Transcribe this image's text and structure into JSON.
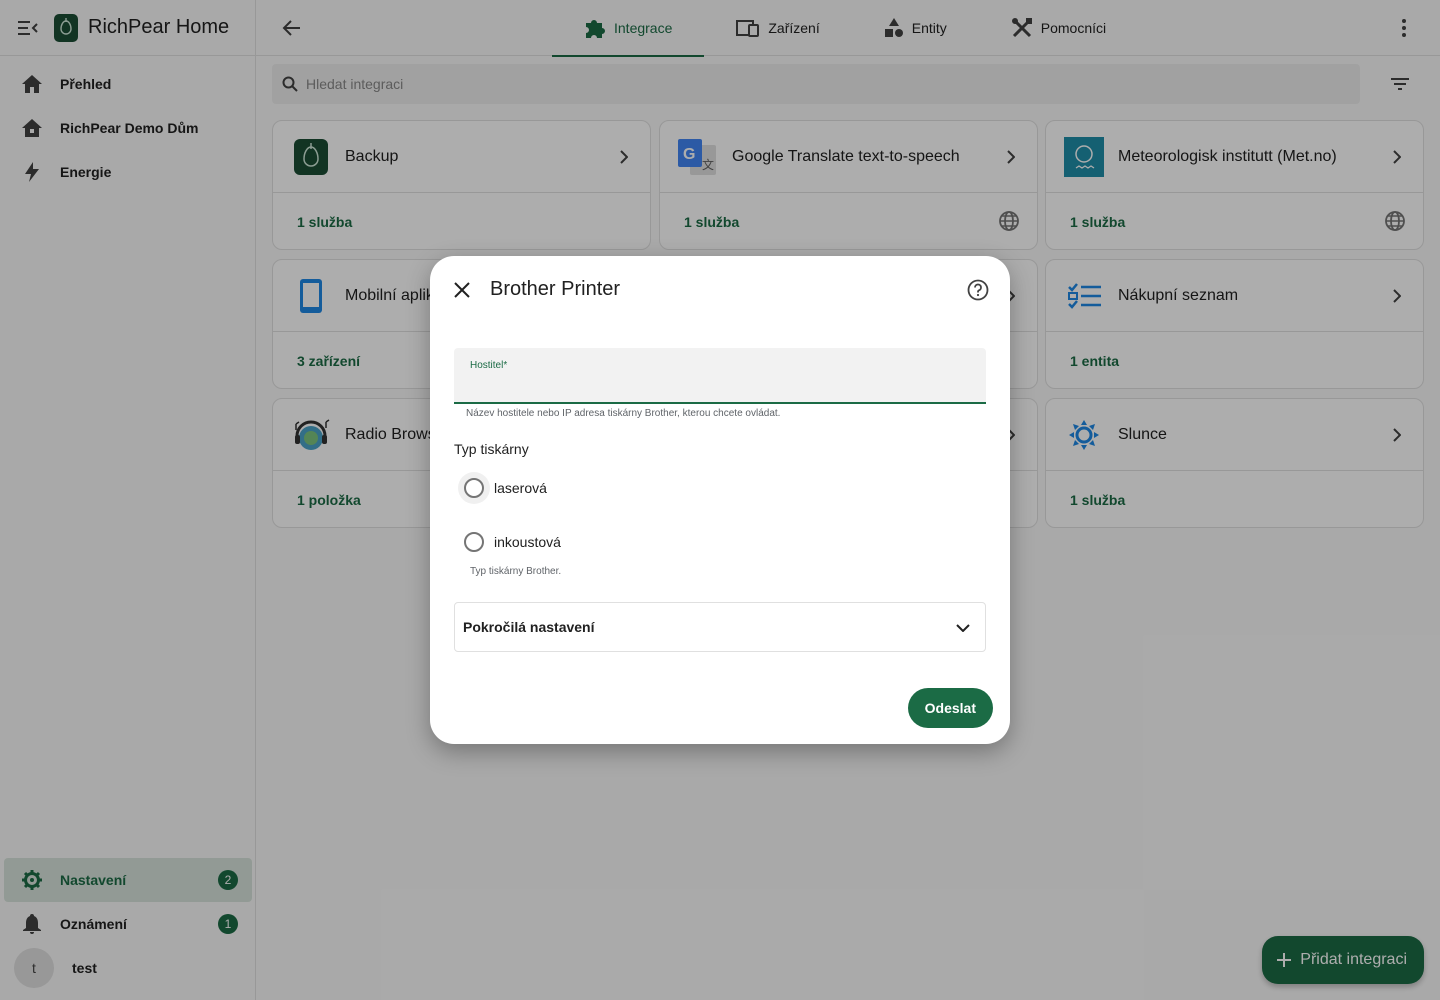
{
  "app": {
    "title": "RichPear Home"
  },
  "sidebar": {
    "items": [
      {
        "label": "Přehled",
        "icon": "home-icon"
      },
      {
        "label": "RichPear Demo Dům",
        "icon": "home-outline-icon"
      },
      {
        "label": "Energie",
        "icon": "lightning-icon"
      }
    ],
    "bottom": [
      {
        "label": "Nastavení",
        "icon": "gear-icon",
        "badge": "2"
      },
      {
        "label": "Oznámení",
        "icon": "bell-icon",
        "badge": "1"
      }
    ],
    "user": {
      "initial": "t",
      "name": "test"
    }
  },
  "tabs": [
    {
      "label": "Integrace",
      "icon": "puzzle-icon"
    },
    {
      "label": "Zařízení",
      "icon": "devices-icon"
    },
    {
      "label": "Entity",
      "icon": "shapes-icon"
    },
    {
      "label": "Pomocníci",
      "icon": "tools-icon"
    }
  ],
  "search": {
    "placeholder": "Hledat integraci"
  },
  "cards": [
    {
      "name": "Backup",
      "count": "1 služba",
      "icon": "richpear-logo-icon",
      "cloud": false
    },
    {
      "name": "Google Translate text-to-speech",
      "count": "1 služba",
      "icon": "google-translate-icon",
      "cloud": true
    },
    {
      "name": "Meteorologisk institutt (Met.no)",
      "count": "1 služba",
      "icon": "met-no-icon",
      "cloud": true
    },
    {
      "name": "Mobilní aplik",
      "count": "3 zařízení",
      "icon": "mobile-app-icon",
      "cloud": false
    },
    {
      "name": "",
      "count": "",
      "icon": "hidden",
      "cloud": false
    },
    {
      "name": "Nákupní seznam",
      "count": "1 entita",
      "icon": "shopping-list-icon",
      "cloud": false
    },
    {
      "name": "Radio Brows",
      "count": "1 položka",
      "icon": "radio-browser-icon",
      "cloud": false
    },
    {
      "name": "",
      "count": "",
      "icon": "hidden",
      "cloud": false
    },
    {
      "name": "Slunce",
      "count": "1 služba",
      "icon": "sun-icon",
      "cloud": false
    }
  ],
  "fab": {
    "label": "Přidat integraci"
  },
  "dialog": {
    "title": "Brother Printer",
    "host_label": "Hostitel*",
    "host_value": "",
    "host_help": "Název hostitele nebo IP adresa tiskárny Brother, kterou chcete ovládat.",
    "type_label": "Typ tiskárny",
    "options": [
      "laserová",
      "inkoustová"
    ],
    "type_help": "Typ tiskárny Brother.",
    "advanced_label": "Pokročilá nastavení",
    "submit_label": "Odeslat"
  },
  "colors": {
    "accent": "#1b6b45",
    "scrim": "rgba(0,0,0,0.32)"
  }
}
